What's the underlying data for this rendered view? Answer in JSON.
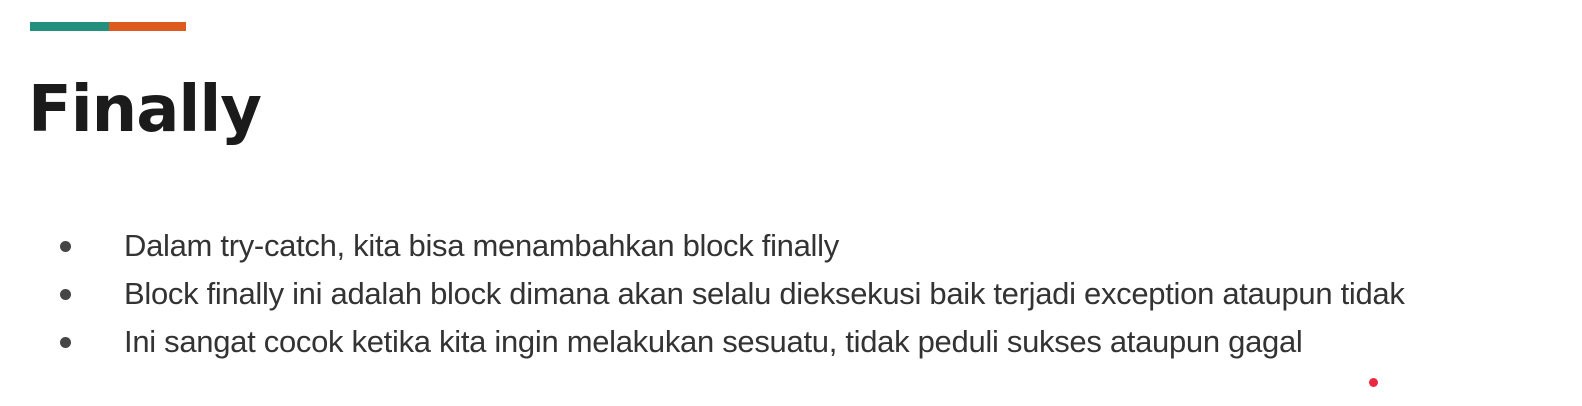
{
  "colors": {
    "accent_teal": "#22907d",
    "accent_orange": "#dd5b1f",
    "title": "#1b1b1b",
    "body_text": "#333333",
    "pointer": "#e8293f"
  },
  "slide": {
    "title": "Finally",
    "bullets": [
      "Dalam try-catch, kita bisa menambahkan block finally",
      "Block finally ini adalah block dimana akan selalu dieksekusi baik terjadi exception ataupun tidak",
      "Ini sangat cocok ketika kita ingin melakukan sesuatu, tidak peduli sukses ataupun gagal"
    ]
  }
}
